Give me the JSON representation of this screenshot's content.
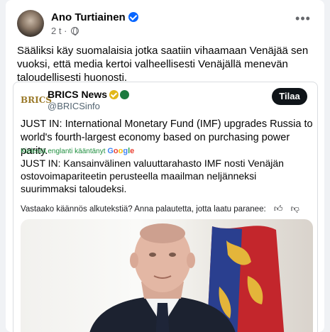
{
  "post": {
    "author": "Ano Turtiainen",
    "time": "2 t",
    "separator": "·",
    "text": "Sääliksi käy suomalaisia jotka saatiin vihaamaan Venäjää sen vuoksi, että media kertoi valheellisesti Venäjällä menevän taloudellisesti huonosti.",
    "more_label": "•••"
  },
  "embed": {
    "logo_text": "BRICS",
    "name": "BRICS News",
    "handle": "@BRICSinfo",
    "subscribe_label": "Tilaa",
    "text_en": "JUST IN: International Monetary Fund (IMF) upgrades Russia to world's fourth-largest economy based on purchasing power parity.",
    "translated_label": "Kielestä englanti kääntänyt",
    "google": "Google",
    "text_fi": "JUST IN: Kansainvälinen valuuttarahasto IMF nosti Venäjän ostovoimapariteetin perusteella maailman neljänneksi suurimmaksi taloudeksi.",
    "feedback": "Vastaako käännös alkutekstiä? Anna palautetta, jotta laatu paranee:"
  },
  "colors": {
    "verified": "#0866ff",
    "brics_gold": "#e2b719",
    "google_blue": "#4285f4",
    "google_red": "#ea4335",
    "google_yellow": "#fbbc05",
    "google_green": "#34a853"
  }
}
